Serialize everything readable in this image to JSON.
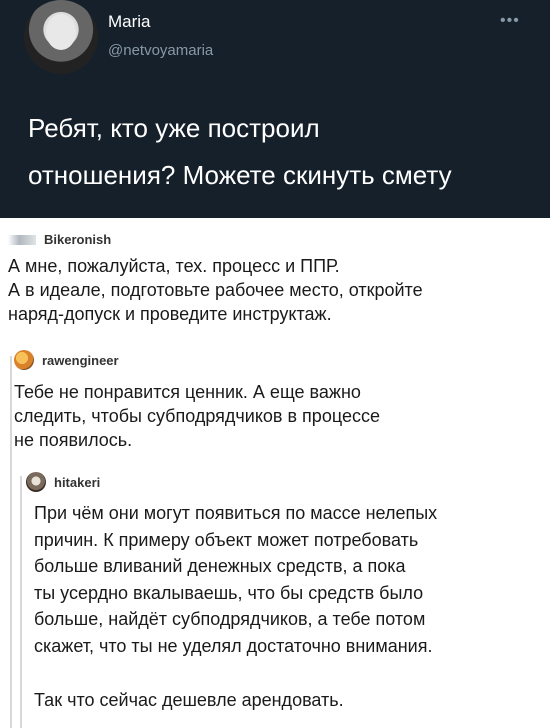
{
  "tweet": {
    "name": "Maria",
    "handle": "@netvoyamaria",
    "text_line1": "Ребят, кто уже построил",
    "text_line2": "отношения? Можете скинуть смету"
  },
  "thread": [
    {
      "username": "Bikeronish",
      "lines": [
        "А мне, пожалуйста, тех. процесс и ППР.",
        "А в идеале, подготовьте рабочее место, откройте",
        "наряд-допуск и проведите инструктаж."
      ]
    },
    {
      "username": "rawengineer",
      "lines": [
        "Тебе не понравится ценник. А еще важно",
        "следить, чтобы субподрядчиков в процессе",
        "не появилось."
      ]
    },
    {
      "username": "hitakeri",
      "lines": [
        "При чём они могут появиться по массе нелепых",
        "причин. К примеру объект может потребовать",
        "больше вливаний денежных средств, а пока",
        "ты усердно вкалываешь, что бы средств было",
        "больше, найдёт субподрядчиков, а тебе потом",
        "скажет, что ты не уделял достаточно внимания."
      ],
      "final_line": "Так что сейчас дешевле арендовать."
    }
  ]
}
